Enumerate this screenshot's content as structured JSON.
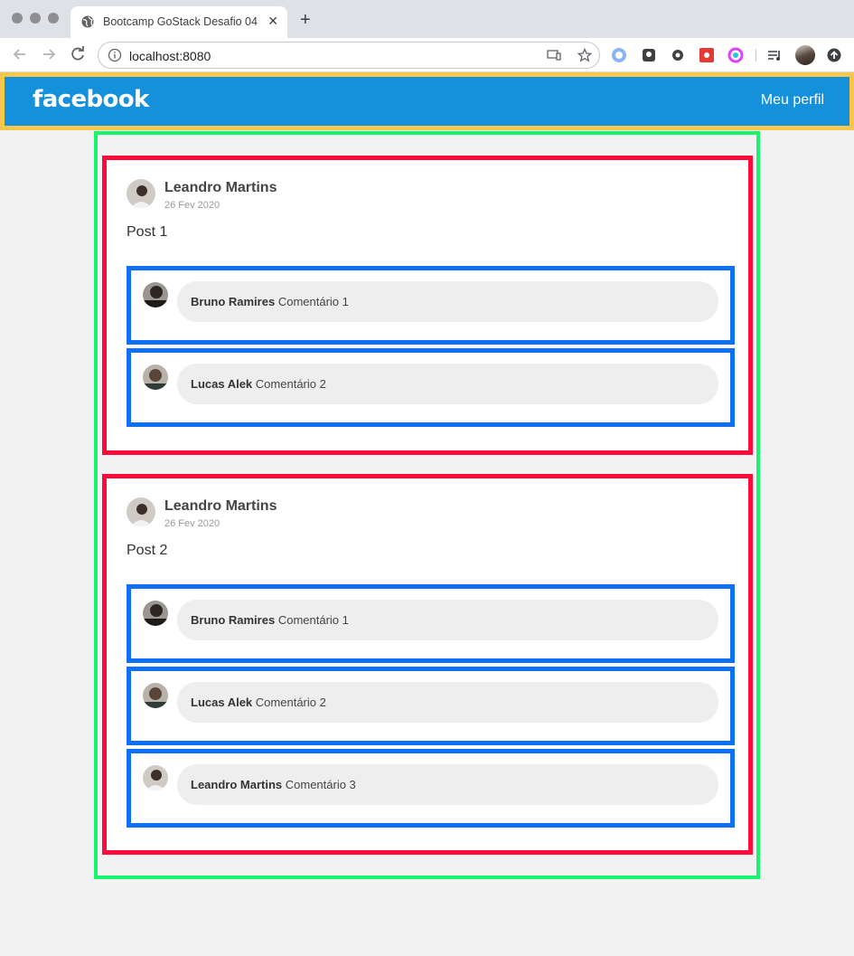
{
  "browser": {
    "tab_title": "Bootcamp GoStack Desafio 04",
    "tab_close": "✕",
    "new_tab": "+",
    "url": "localhost:8080"
  },
  "header": {
    "logo": "facebook",
    "profile_link": "Meu perfil"
  },
  "posts": [
    {
      "author": "Leandro Martins",
      "date": "26 Fev 2020",
      "content": "Post 1",
      "comments": [
        {
          "author": "Bruno Ramires",
          "content": "Comentário 1"
        },
        {
          "author": "Lucas Alek",
          "content": "Comentário 2"
        }
      ]
    },
    {
      "author": "Leandro Martins",
      "date": "26 Fev 2020",
      "content": "Post 2",
      "comments": [
        {
          "author": "Bruno Ramires",
          "content": "Comentário 1"
        },
        {
          "author": "Lucas Alek",
          "content": "Comentário 2"
        },
        {
          "author": "Leandro Martins",
          "content": "Comentário 3"
        }
      ]
    }
  ],
  "colors": {
    "header_bg": "#1591db",
    "header_outline": "#f7c64a",
    "post_list_outline": "#16f56b",
    "post_outline": "#ff0a3a",
    "comment_outline": "#0f6ff5",
    "bubble_bg": "#eeeeee"
  }
}
